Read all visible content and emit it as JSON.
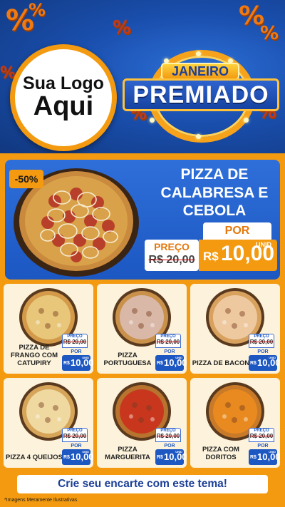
{
  "header": {
    "logo_line1": "Sua Logo",
    "logo_line2": "Aqui",
    "badge_top": "JANEIRO",
    "badge_main": "PREMIADO",
    "percent_symbol": "%"
  },
  "feature": {
    "discount": "-50%",
    "title": "PIZZA DE CALABRESA E CEBOLA",
    "por_label": "POR",
    "preco_label": "PREÇO",
    "old_price": "R$ 20,00",
    "currency": "R$",
    "new_price": "10,00",
    "unit": "UNID"
  },
  "products": [
    {
      "name": "PIZZA DE FRANGO COM CATUPIRY",
      "preco_label": "PREÇO",
      "old_price": "R$ 20,00",
      "por_label": "POR",
      "currency": "R$",
      "new_price": "10,00",
      "unit": "UNID",
      "topping": "#e8c77a",
      "crust": "#d49a4a"
    },
    {
      "name": "PIZZA PORTUGUESA",
      "preco_label": "PREÇO",
      "old_price": "R$ 20,00",
      "por_label": "POR",
      "currency": "R$",
      "new_price": "10,00",
      "unit": "UNID",
      "topping": "#d9b8a8",
      "crust": "#c9914a"
    },
    {
      "name": "PIZZA DE BACON",
      "preco_label": "PREÇO",
      "old_price": "R$ 20,00",
      "por_label": "POR",
      "currency": "R$",
      "new_price": "10,00",
      "unit": "UNID",
      "topping": "#eec9a0",
      "crust": "#d8a25e"
    },
    {
      "name": "PIZZA 4 QUEIJOS",
      "preco_label": "PREÇO",
      "old_price": "R$ 20,00",
      "por_label": "POR",
      "currency": "R$",
      "new_price": "10,00",
      "unit": "UNID",
      "topping": "#efd9a0",
      "crust": "#d6a55a"
    },
    {
      "name": "PIZZA MARGUERITA",
      "preco_label": "PREÇO",
      "old_price": "R$ 20,00",
      "por_label": "POR",
      "currency": "R$",
      "new_price": "10,00",
      "unit": "UNID",
      "topping": "#c9361e",
      "crust": "#b8742e"
    },
    {
      "name": "PIZZA COM DORITOS",
      "preco_label": "PREÇO",
      "old_price": "R$ 20,00",
      "por_label": "POR",
      "currency": "R$",
      "new_price": "10,00",
      "unit": "UNID",
      "topping": "#e88a1f",
      "crust": "#c97a28"
    }
  ],
  "cta": "Crie seu encarte com este tema!",
  "footnote": "*Imagens Meramente Ilustrativas",
  "colors": {
    "brand_blue": "#1c57c2",
    "brand_orange": "#f39a10",
    "card_bg": "#fdf3dc"
  }
}
